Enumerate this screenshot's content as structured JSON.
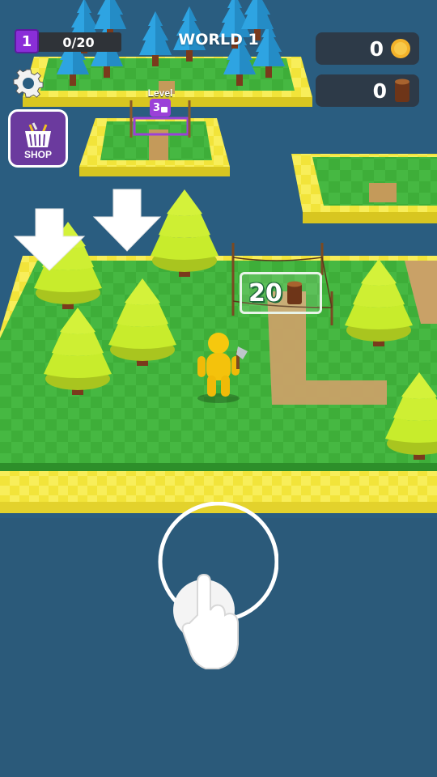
{
  "hud": {
    "player_level": "1",
    "xp_progress": "0/20",
    "xp_fraction": 0,
    "world_title": "WORLD 1",
    "coins": "0",
    "wood": "0",
    "shop_label": "SHOP"
  },
  "world": {
    "locked_island_label": "Level",
    "locked_island_level": "3",
    "build_cost": "20"
  },
  "colors": {
    "water": "#2b5b7d",
    "grass": "#3fae3a",
    "sand": "#f2e53a",
    "tree_pine": "#c9ef2d",
    "tree_blue": "#2fa3e0",
    "player": "#f6c80e",
    "hud_panel": "#2d3a48",
    "level_badge": "#8a2ed8",
    "shop_button": "#6b3a9e"
  },
  "icons": {
    "settings": "gear-icon",
    "shop": "basket-icon",
    "coin": "coin-icon",
    "wood": "log-icon",
    "lock": "lock-icon",
    "tutorial": "tap-hand-icon"
  }
}
